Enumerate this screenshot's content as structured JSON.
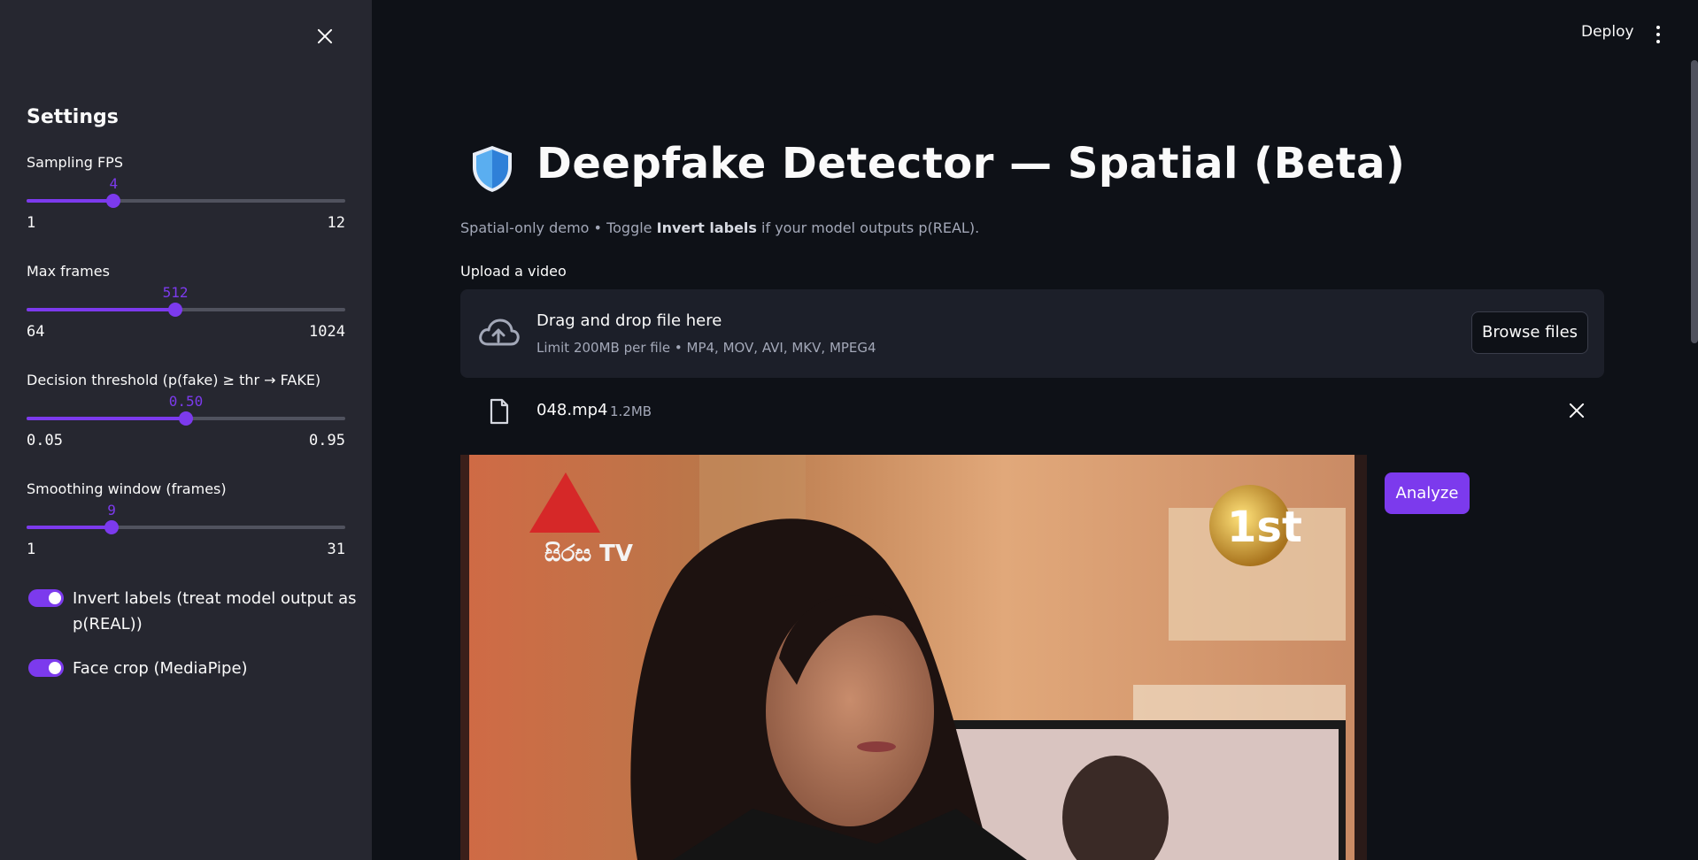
{
  "topbar": {
    "deploy_label": "Deploy"
  },
  "sidebar": {
    "title": "Settings",
    "sliders": [
      {
        "label": "Sampling FPS",
        "value": "4",
        "min": "1",
        "max": "12",
        "fraction": 0.273
      },
      {
        "label": "Max frames",
        "value": "512",
        "min": "64",
        "max": "1024",
        "fraction": 0.467
      },
      {
        "label": "Decision threshold (p(fake) ≥ thr → FAKE)",
        "value": "0.50",
        "min": "0.05",
        "max": "0.95",
        "fraction": 0.5
      },
      {
        "label": "Smoothing window (frames)",
        "value": "9",
        "min": "1",
        "max": "31",
        "fraction": 0.267
      }
    ],
    "toggles": [
      {
        "label": "Invert labels (treat model output as p(REAL))",
        "on": true
      },
      {
        "label": "Face crop (MediaPipe)",
        "on": true
      }
    ]
  },
  "main": {
    "title": "Deepfake Detector — Spatial (Beta)",
    "subtitle_pre": "Spatial-only demo • Toggle ",
    "subtitle_bold": "Invert labels",
    "subtitle_post": " if your model outputs p(REAL).",
    "upload_label": "Upload a video",
    "dropzone": {
      "main_text": "Drag and drop file here",
      "sub_text": "Limit 200MB per file • MP4, MOV, AVI, MKV, MPEG4",
      "browse_label": "Browse files"
    },
    "file": {
      "name": "048.mp4",
      "size": "1.2MB"
    },
    "analyze_label": "Analyze",
    "video_overlay_text": "සිරස TV",
    "video_logo_text": "1st"
  },
  "colors": {
    "accent": "#7c3aed",
    "background": "#0e1117",
    "sidebar": "#262730"
  },
  "icons": [
    "close-icon",
    "shield-icon",
    "cloud-upload-icon",
    "file-icon",
    "more-vert-icon"
  ]
}
